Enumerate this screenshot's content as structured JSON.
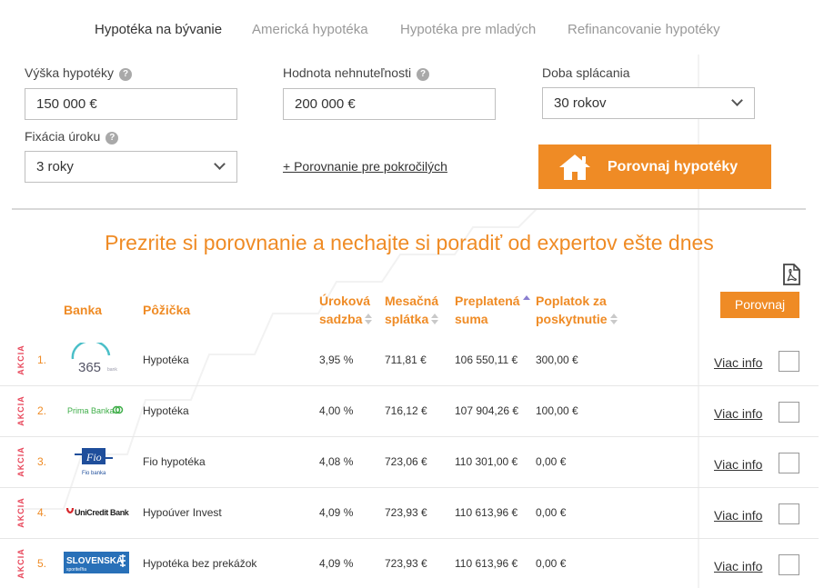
{
  "tabs": [
    {
      "label": "Hypotéka na bývanie"
    },
    {
      "label": "Americká hypotéka"
    },
    {
      "label": "Hypotéka pre mladých"
    },
    {
      "label": "Refinancovanie hypotéky"
    }
  ],
  "form": {
    "amount_label": "Výška hypotéky",
    "amount_value": "150 000 €",
    "property_label": "Hodnota nehnuteľnosti",
    "property_value": "200 000 €",
    "term_label": "Doba splácania",
    "term_value": "30 rokov",
    "fixation_label": "Fixácia úroku",
    "fixation_value": "3 roky",
    "help_glyph": "?",
    "advanced_link": "+ Porovnanie pre pokročilých",
    "submit_label": "Porovnaj hypotéky"
  },
  "headline": "Prezrite si porovnanie a nechajte si poradiť od expertov ešte dnes",
  "compare_button": "Porovnaj",
  "table": {
    "headers": {
      "bank": "Banka",
      "loan": "Pôžička",
      "rate_1": "Úroková",
      "rate_2": "sadzba",
      "monthly_1": "Mesačná",
      "monthly_2": "splátka",
      "overpaid_1": "Preplatená",
      "overpaid_2": "suma",
      "fee_1": "Poplatok za",
      "fee_2": "poskytnutie"
    },
    "rows": [
      {
        "badge": "AKCIA",
        "rank": "1.",
        "bank_logo": "365",
        "bank_logo_sub": "bank",
        "loan": "Hypotéka",
        "rate": "3,95 %",
        "monthly": "711,81 €",
        "overpaid": "106 550,11 €",
        "fee": "300,00 €",
        "more": "Viac info"
      },
      {
        "badge": "AKCIA",
        "rank": "2.",
        "bank_logo": "Prima Banka",
        "loan": "Hypotéka",
        "rate": "4,00 %",
        "monthly": "716,12 €",
        "overpaid": "107 904,26 €",
        "fee": "100,00 €",
        "more": "Viac info"
      },
      {
        "badge": "AKCIA",
        "rank": "3.",
        "bank_logo": "Fio",
        "bank_logo_sub": "Fio banka",
        "loan": "Fio hypotéka",
        "rate": "4,08 %",
        "monthly": "723,06 €",
        "overpaid": "110 301,00 €",
        "fee": "0,00 €",
        "more": "Viac info"
      },
      {
        "badge": "AKCIA",
        "rank": "4.",
        "bank_logo": "UniCredit Bank",
        "loan": "Hypoúver Invest",
        "rate": "4,09 %",
        "monthly": "723,93 €",
        "overpaid": "110 613,96 €",
        "fee": "0,00 €",
        "more": "Viac info"
      },
      {
        "badge": "AKCIA",
        "rank": "5.",
        "bank_logo": "SLOVENSKÁ",
        "bank_logo_sub": "sporiteľňa",
        "loan": "Hypotéka bez prekážok",
        "rate": "4,09 %",
        "monthly": "723,93 €",
        "overpaid": "110 613,96 €",
        "fee": "0,00 €",
        "more": "Viac info"
      }
    ]
  },
  "colors": {
    "accent": "#ef8b25",
    "badge": "#e8465a",
    "logo_365": "#4bbfc8",
    "logo_prima": "#3fae49",
    "logo_fio": "#1f4e9b",
    "logo_unicredit": "#d6262b",
    "logo_slsp": "#2870b8"
  }
}
